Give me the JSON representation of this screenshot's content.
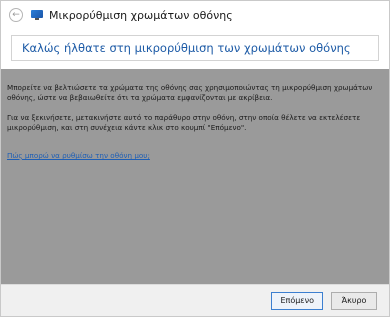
{
  "window": {
    "title": "Μικρορύθμιση χρωμάτων οθόνης",
    "back_icon": "back-arrow-icon",
    "app_icon": "display-color-icon"
  },
  "header": {
    "heading": "Καλώς ήλθατε στη μικρορύθμιση των χρωμάτων οθόνης"
  },
  "body": {
    "para1": "Μπορείτε να βελτιώσετε τα χρώματα της οθόνης σας χρησιμοποιώντας τη μικρορύθμιση χρωμάτων οθόνης, ώστε να βεβαιωθείτε ότι τα χρώματα εμφανίζονται με ακρίβεια.",
    "para2": "Για να ξεκινήσετε, μετακινήστε αυτό το παράθυρο στην οθόνη, στην οποία θέλετε να εκτελέσετε μικρορύθμιση, και στη συνέχεια κάντε κλικ στο κουμπί \"Επόμενο\".",
    "help_link": "Πώς μπορώ να ρυθμίσω την οθόνη μου;"
  },
  "footer": {
    "next_label": "Επόμενο",
    "cancel_label": "Άκυρο"
  }
}
